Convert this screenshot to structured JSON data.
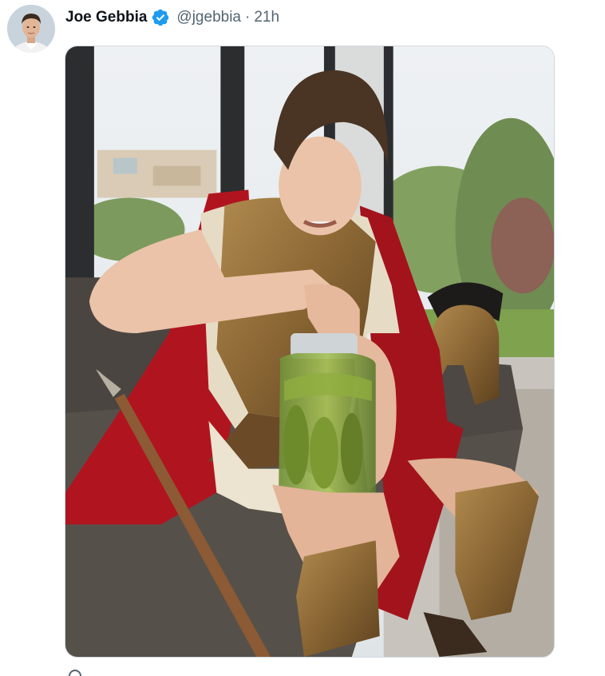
{
  "tweet": {
    "author": {
      "display_name": "Joe Gebbia",
      "handle": "@jgebbia",
      "verified": true,
      "avatar_icon": "profile-photo"
    },
    "separator": "·",
    "timestamp": "21h",
    "media": {
      "type": "photo",
      "icon": "photo"
    }
  },
  "colors": {
    "text_primary": "#0f1419",
    "text_secondary": "#536471",
    "verified_blue": "#1d9bf0",
    "border": "#cfd9de"
  }
}
